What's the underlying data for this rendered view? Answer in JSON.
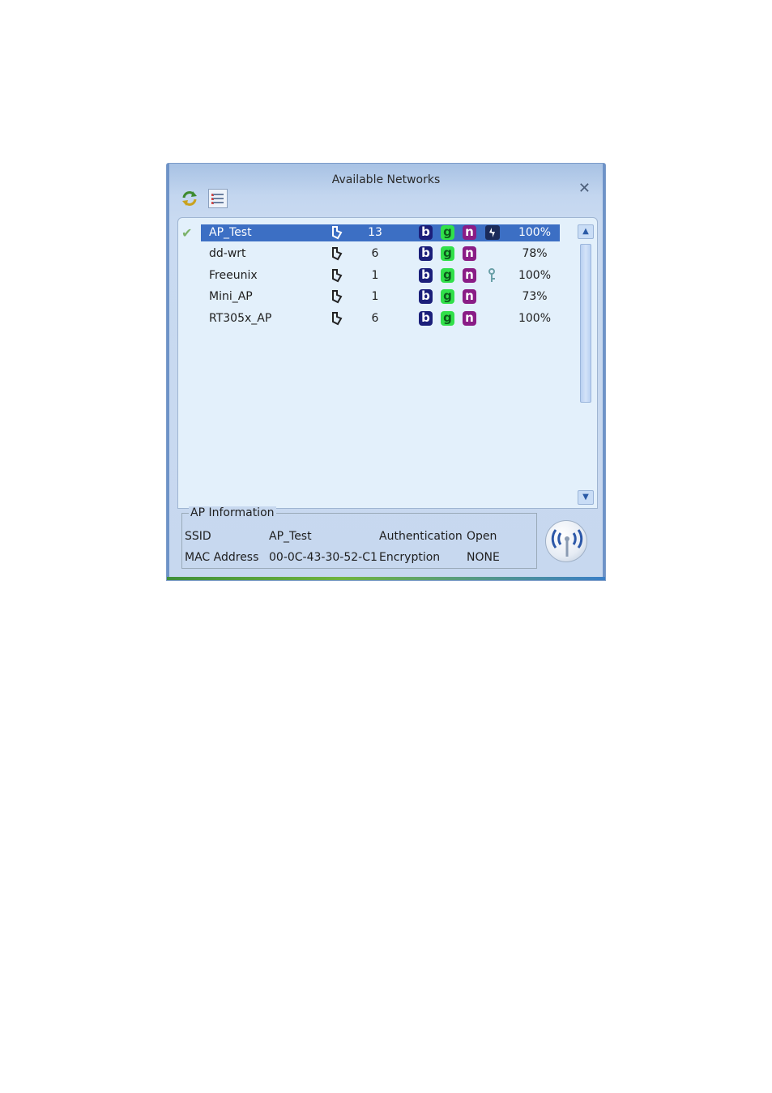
{
  "window": {
    "title": "Available Networks",
    "close_label": "✕"
  },
  "toolbar": {
    "refresh_icon": "refresh-icon",
    "list_icon": "list-view-icon"
  },
  "networks": [
    {
      "ssid": "AP_Test",
      "channel": "13",
      "modes": [
        "b",
        "g",
        "n"
      ],
      "security": "wps",
      "signal": "100%",
      "connected": true
    },
    {
      "ssid": "dd-wrt",
      "channel": "6",
      "modes": [
        "b",
        "g",
        "n"
      ],
      "security": "",
      "signal": "78%",
      "connected": false
    },
    {
      "ssid": "Freeunix",
      "channel": "1",
      "modes": [
        "b",
        "g",
        "n"
      ],
      "security": "key",
      "signal": "100%",
      "connected": false
    },
    {
      "ssid": "Mini_AP",
      "channel": "1",
      "modes": [
        "b",
        "g",
        "n"
      ],
      "security": "",
      "signal": "73%",
      "connected": false
    },
    {
      "ssid": "RT305x_AP",
      "channel": "6",
      "modes": [
        "b",
        "g",
        "n"
      ],
      "security": "",
      "signal": "100%",
      "connected": false
    }
  ],
  "mode_labels": {
    "b": "b",
    "g": "g",
    "n": "n"
  },
  "ap_info": {
    "legend": "AP Information",
    "ssid_label": "SSID",
    "ssid_value": "AP_Test",
    "auth_label": "Authentication",
    "auth_value": "Open",
    "mac_label": "MAC Address",
    "mac_value": "00-0C-43-30-52-C1",
    "enc_label": "Encryption",
    "enc_value": "NONE"
  },
  "colors": {
    "selection": "#3c6fc4",
    "panel": "#e3f0fb",
    "b_badge": "#1b1f7a",
    "g_badge": "#31e04a",
    "n_badge": "#8a1d86"
  }
}
